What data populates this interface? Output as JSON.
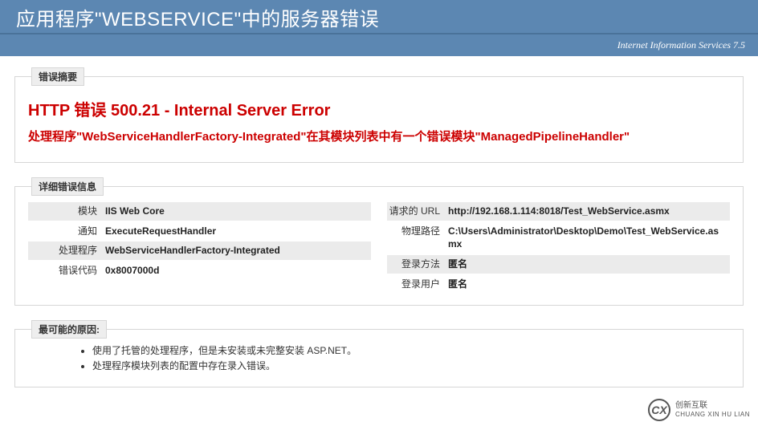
{
  "header": {
    "title": "应用程序\"WEBSERVICE\"中的服务器错误"
  },
  "subheader": {
    "text": "Internet Information Services 7.5"
  },
  "summary": {
    "legend": "错误摘要",
    "title": "HTTP 错误 500.21 - Internal Server Error",
    "subtitle": "处理程序\"WebServiceHandlerFactory-Integrated\"在其模块列表中有一个错误模块\"ManagedPipelineHandler\""
  },
  "details": {
    "legend": "详细错误信息",
    "left": [
      {
        "label": "模块",
        "value": "IIS Web Core"
      },
      {
        "label": "通知",
        "value": "ExecuteRequestHandler"
      },
      {
        "label": "处理程序",
        "value": "WebServiceHandlerFactory-Integrated"
      },
      {
        "label": "错误代码",
        "value": "0x8007000d"
      }
    ],
    "right": [
      {
        "label": "请求的 URL",
        "value": "http://192.168.1.114:8018/Test_WebService.asmx"
      },
      {
        "label": "物理路径",
        "value": "C:\\Users\\Administrator\\Desktop\\Demo\\Test_WebService.asmx"
      },
      {
        "label": "登录方法",
        "value": "匿名"
      },
      {
        "label": "登录用户",
        "value": "匿名"
      }
    ]
  },
  "causes": {
    "legend": "最可能的原因:",
    "items": [
      "使用了托管的处理程序，但是未安装或未完整安装 ASP.NET。",
      "处理程序模块列表的配置中存在录入错误。"
    ]
  },
  "watermark": {
    "logo": "CX",
    "text": "创新互联",
    "pinyin": "CHUANG XIN HU LIAN"
  }
}
